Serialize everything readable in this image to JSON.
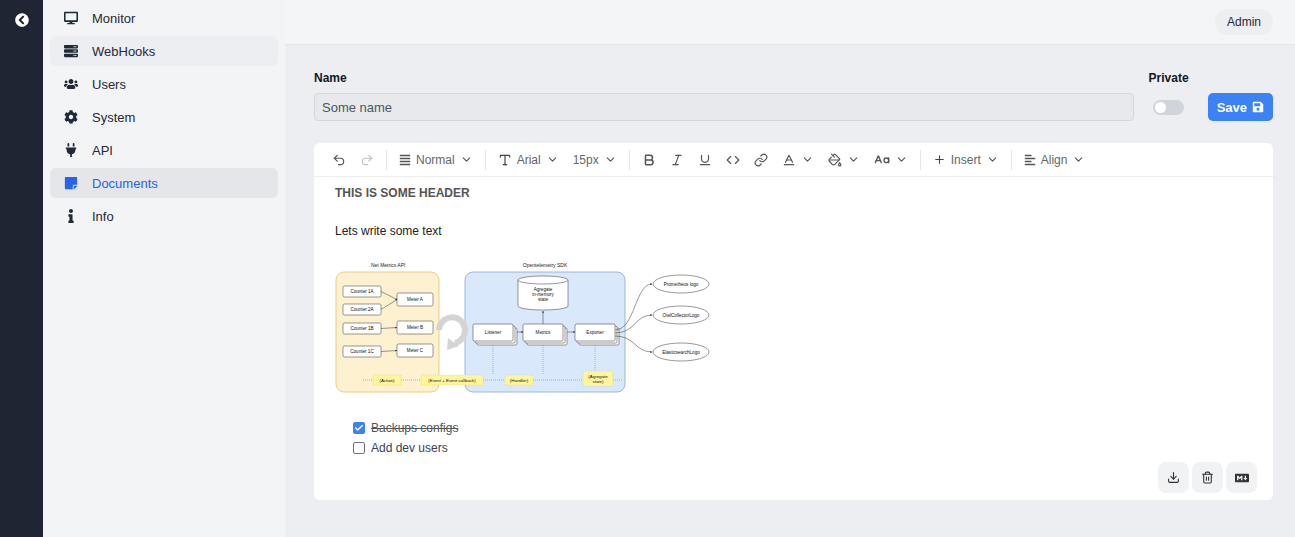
{
  "sidebar": {
    "items": [
      {
        "label": "Monitor",
        "selected": false,
        "hovered": false
      },
      {
        "label": "WebHooks",
        "selected": false,
        "hovered": true
      },
      {
        "label": "Users",
        "selected": false,
        "hovered": false
      },
      {
        "label": "System",
        "selected": false,
        "hovered": false
      },
      {
        "label": "API",
        "selected": false,
        "hovered": false
      },
      {
        "label": "Documents",
        "selected": true,
        "hovered": false
      },
      {
        "label": "Info",
        "selected": false,
        "hovered": false
      }
    ]
  },
  "topbar": {
    "user": "Admin"
  },
  "form": {
    "name_label": "Name",
    "name_value": "Some name",
    "private_label": "Private",
    "private_on": false,
    "save_label": "Save"
  },
  "toolbar": {
    "undo_enabled": true,
    "redo_enabled": false,
    "block_type": "Normal",
    "font_family": "Arial",
    "font_size": "15px",
    "insert": "Insert",
    "align": "Align"
  },
  "editor": {
    "heading": "THIS IS SOME HEADER",
    "paragraph": "Lets write some text",
    "diagram": {
      "groups": [
        {
          "title": ".Net Metrics API"
        },
        {
          "title": "Opentelemetry SDK"
        }
      ],
      "counters": [
        "Counter 1A",
        "Counter 2A",
        "Counter 1B",
        "Counter 1C"
      ],
      "meters": [
        "Meter A",
        "Meter B",
        "Meter C"
      ],
      "store_lines": [
        "Agregate",
        "in-memory",
        "state"
      ],
      "pipeline": [
        "Listener",
        "Metrics",
        "Exporter"
      ],
      "targets": [
        "Prometheus logo",
        "OtelCollectorLogo",
        "ElasticsearchLogo"
      ],
      "flow": [
        {
          "lines": [
            "(Action)"
          ]
        },
        {
          "lines": [
            "(Event + Event callback)"
          ]
        },
        {
          "lines": [
            "(Handler)"
          ]
        },
        {
          "lines": [
            "(Agregate",
            "state)"
          ]
        }
      ]
    },
    "checklist": [
      {
        "label": "Backups configs",
        "checked": true
      },
      {
        "label": "Add dev users",
        "checked": false
      }
    ]
  }
}
